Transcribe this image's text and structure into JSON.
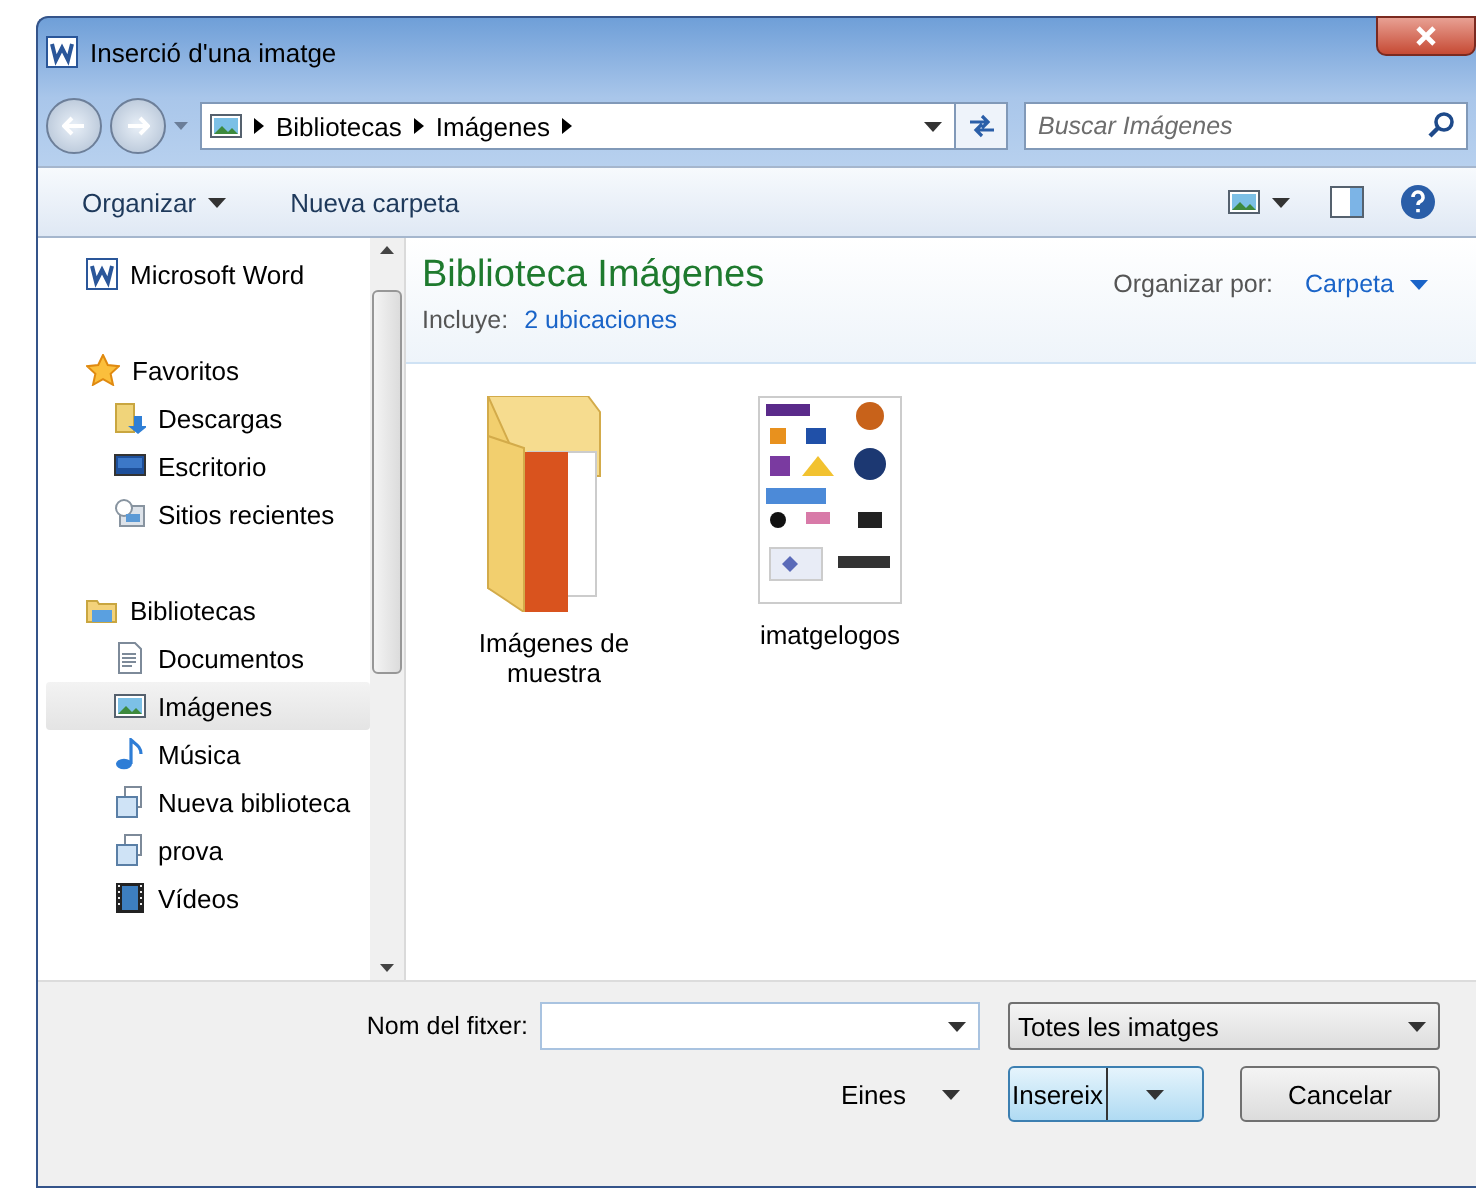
{
  "window": {
    "title": "Inserció d'una imatge"
  },
  "address": {
    "crumbs": [
      "Bibliotecas",
      "Imágenes"
    ]
  },
  "search": {
    "placeholder": "Buscar Imágenes"
  },
  "toolbar": {
    "items": [
      {
        "label": "Organizar",
        "dropdown": true
      },
      {
        "label": "Nueva carpeta",
        "dropdown": false
      }
    ]
  },
  "sidebar": {
    "items": [
      {
        "label": "Microsoft Word",
        "kind": "word",
        "selected": false
      },
      {
        "label": "Favoritos",
        "kind": "star",
        "selected": false,
        "children": [
          {
            "label": "Descargas",
            "kind": "downloads",
            "selected": false
          },
          {
            "label": "Escritorio",
            "kind": "desktop",
            "selected": false
          },
          {
            "label": "Sitios recientes",
            "kind": "recent",
            "selected": false
          }
        ]
      },
      {
        "label": "Bibliotecas",
        "kind": "library",
        "selected": false,
        "children": [
          {
            "label": "Documentos",
            "kind": "document",
            "selected": false
          },
          {
            "label": "Imágenes",
            "kind": "picture",
            "selected": true
          },
          {
            "label": "Música",
            "kind": "music",
            "selected": false
          },
          {
            "label": "Nueva biblioteca",
            "kind": "generic",
            "selected": false
          },
          {
            "label": "prova",
            "kind": "generic",
            "selected": false
          },
          {
            "label": "Vídeos",
            "kind": "video",
            "selected": false
          }
        ]
      }
    ]
  },
  "library": {
    "title": "Biblioteca Imágenes",
    "includes_label": "Incluye:",
    "includes_link": "2 ubicaciones",
    "arrange_label": "Organizar por:",
    "arrange_value": "Carpeta"
  },
  "files": [
    {
      "name": "Imágenes de muestra",
      "kind": "folder"
    },
    {
      "name": "imatgelogos",
      "kind": "image"
    }
  ],
  "footer": {
    "filename_label": "Nom del fitxer:",
    "filter": "Totes les imatges",
    "tools": "Eines",
    "insert": "Insereix",
    "cancel": "Cancelar"
  }
}
